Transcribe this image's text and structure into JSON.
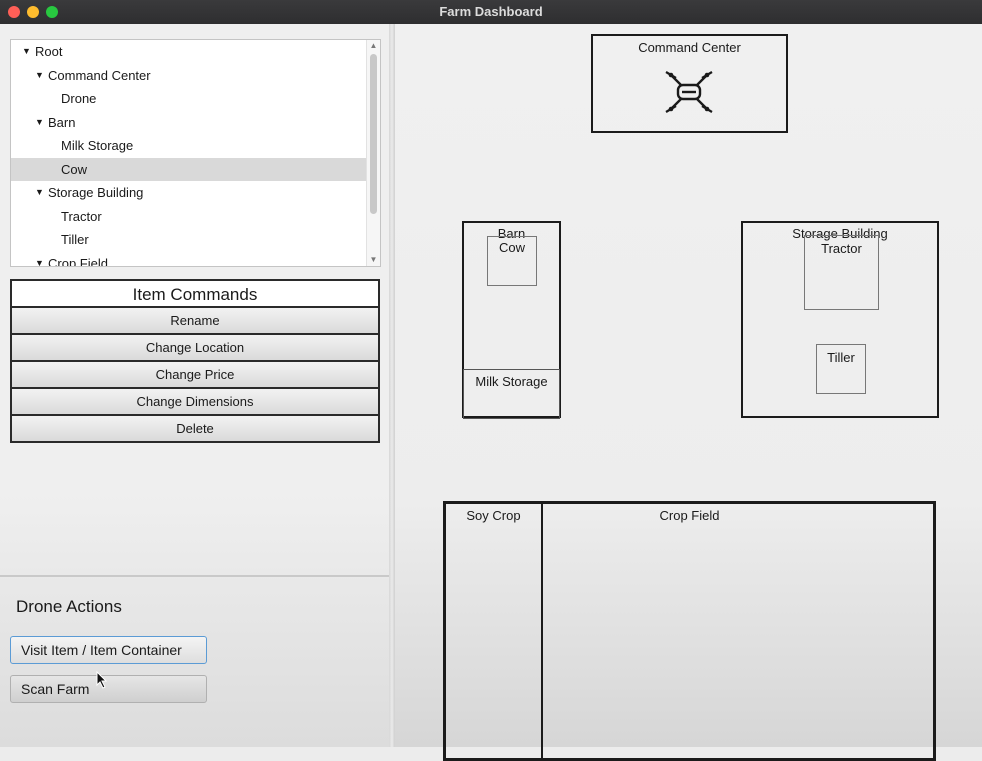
{
  "window": {
    "title": "Farm Dashboard"
  },
  "tree": {
    "items": [
      {
        "label": "Root",
        "level": 0,
        "expanded": true
      },
      {
        "label": "Command Center",
        "level": 1,
        "expanded": true
      },
      {
        "label": "Drone",
        "level": 2
      },
      {
        "label": "Barn",
        "level": 1,
        "expanded": true
      },
      {
        "label": "Milk Storage",
        "level": 2
      },
      {
        "label": "Cow",
        "level": 2,
        "selected": true
      },
      {
        "label": "Storage Building",
        "level": 1,
        "expanded": true
      },
      {
        "label": "Tractor",
        "level": 2
      },
      {
        "label": "Tiller",
        "level": 2
      },
      {
        "label": "Crop Field",
        "level": 1,
        "expanded": true
      }
    ]
  },
  "item_commands": {
    "title": "Item Commands",
    "buttons": [
      "Rename",
      "Change Location",
      "Change Price",
      "Change Dimensions",
      "Delete"
    ]
  },
  "drone_actions": {
    "title": "Drone Actions",
    "visit_label": "Visit Item / Item Container",
    "scan_label": "Scan Farm"
  },
  "farm_map": {
    "command_center": {
      "label": "Command Center",
      "icon": "drone-icon"
    },
    "barn": {
      "label": "Barn",
      "cow_label": "Cow",
      "milk_label": "Milk Storage"
    },
    "storage_building": {
      "label": "Storage Building",
      "tractor_label": "Tractor",
      "tiller_label": "Tiller"
    },
    "crop_field": {
      "label": "Crop Field",
      "soy_label": "Soy Crop"
    }
  }
}
